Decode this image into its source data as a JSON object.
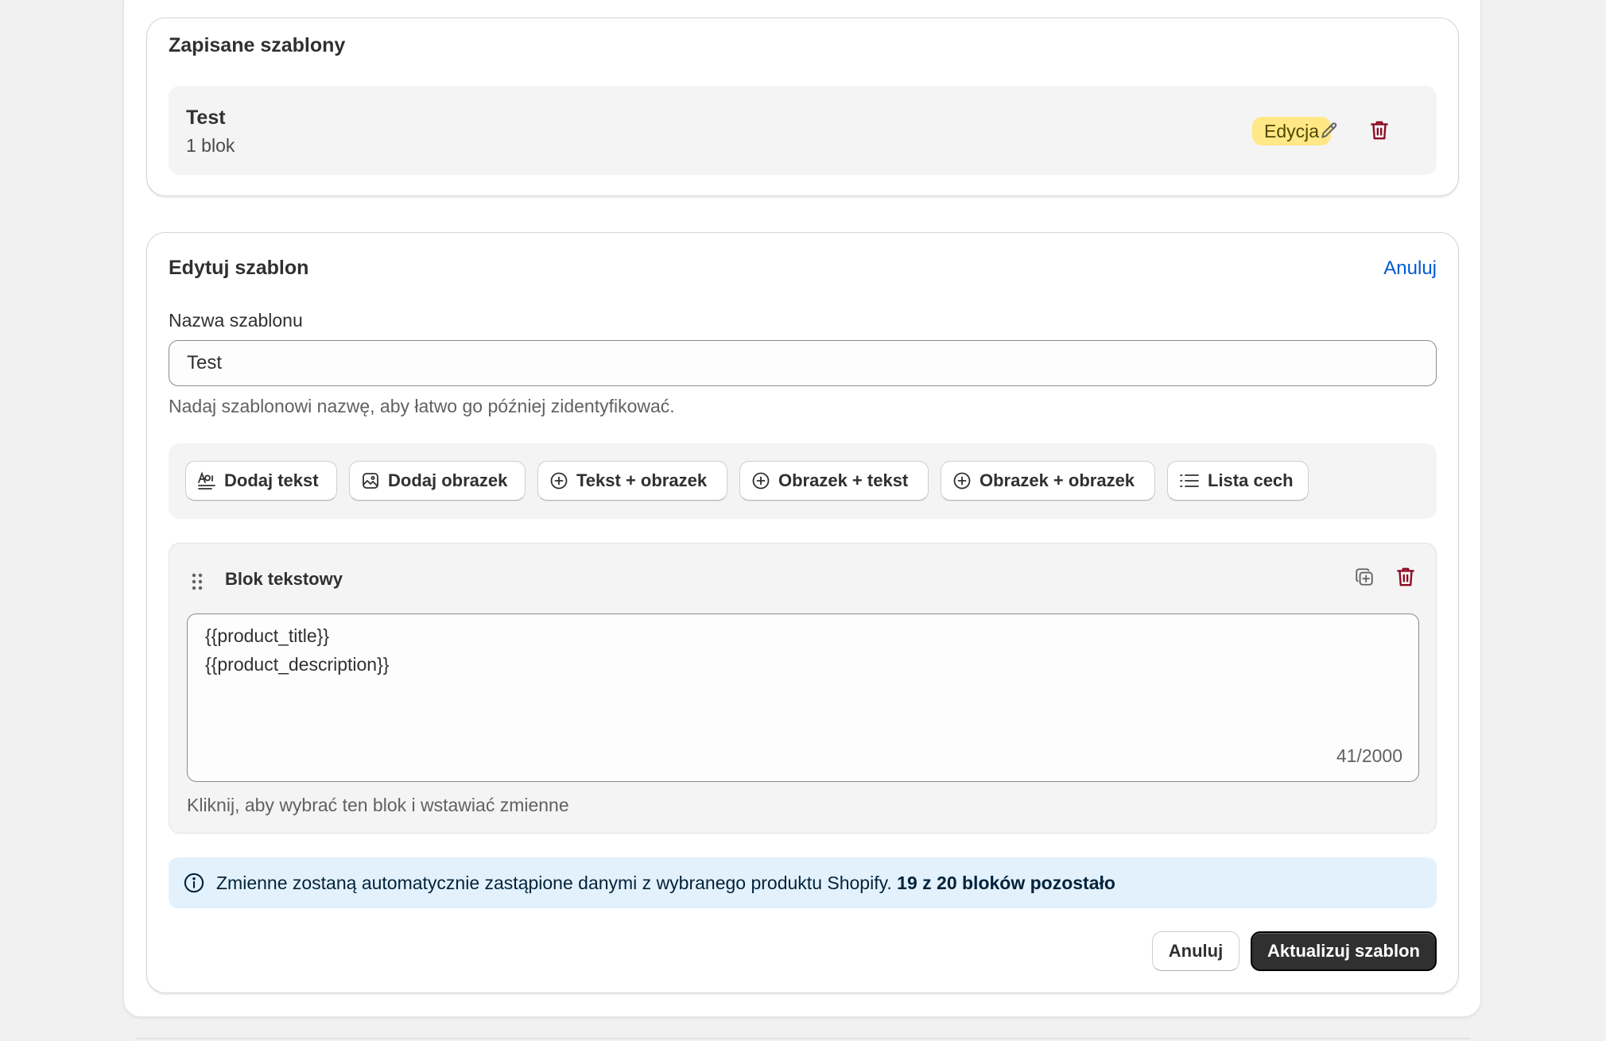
{
  "saved_templates": {
    "title": "Zapisane szablony",
    "items": [
      {
        "name": "Test",
        "count": "1 blok",
        "badge": "Edycja"
      }
    ]
  },
  "edit_template": {
    "title": "Edytuj szablon",
    "cancel_link": "Anuluj",
    "name_label": "Nazwa szablonu",
    "name_value": "Test",
    "name_help": "Nadaj szablonowi nazwę, aby łatwo go później zidentyfikować.",
    "toolbar": [
      {
        "label": "Dodaj tekst",
        "icon": "text-format-icon"
      },
      {
        "label": "Dodaj obrazek",
        "icon": "image-icon"
      },
      {
        "label": "Tekst + obrazek",
        "icon": "plus-circle-icon"
      },
      {
        "label": "Obrazek + tekst",
        "icon": "plus-circle-icon"
      },
      {
        "label": "Obrazek + obrazek",
        "icon": "plus-circle-icon"
      },
      {
        "label": "Lista cech",
        "icon": "list-icon"
      }
    ],
    "block": {
      "title": "Blok tekstowy",
      "content_lines": [
        "{{product_title}}",
        "{{product_description}}"
      ],
      "counter": "41/2000",
      "help": "Kliknij, aby wybrać ten blok i wstawiać zmienne"
    },
    "banner": {
      "text": "Zmienne zostaną automatycznie zastąpione danymi z wybranego produktu Shopify.",
      "emphasis": "19 z 20 bloków pozostało"
    },
    "cancel_button": "Anuluj",
    "submit_button": "Aktualizuj szablon"
  },
  "colors": {
    "accent_link": "#005bd3",
    "critical": "#8e0b21",
    "badge_bg": "#ffe885",
    "banner_bg": "#e3f1fd",
    "primary_button": "#303030"
  }
}
